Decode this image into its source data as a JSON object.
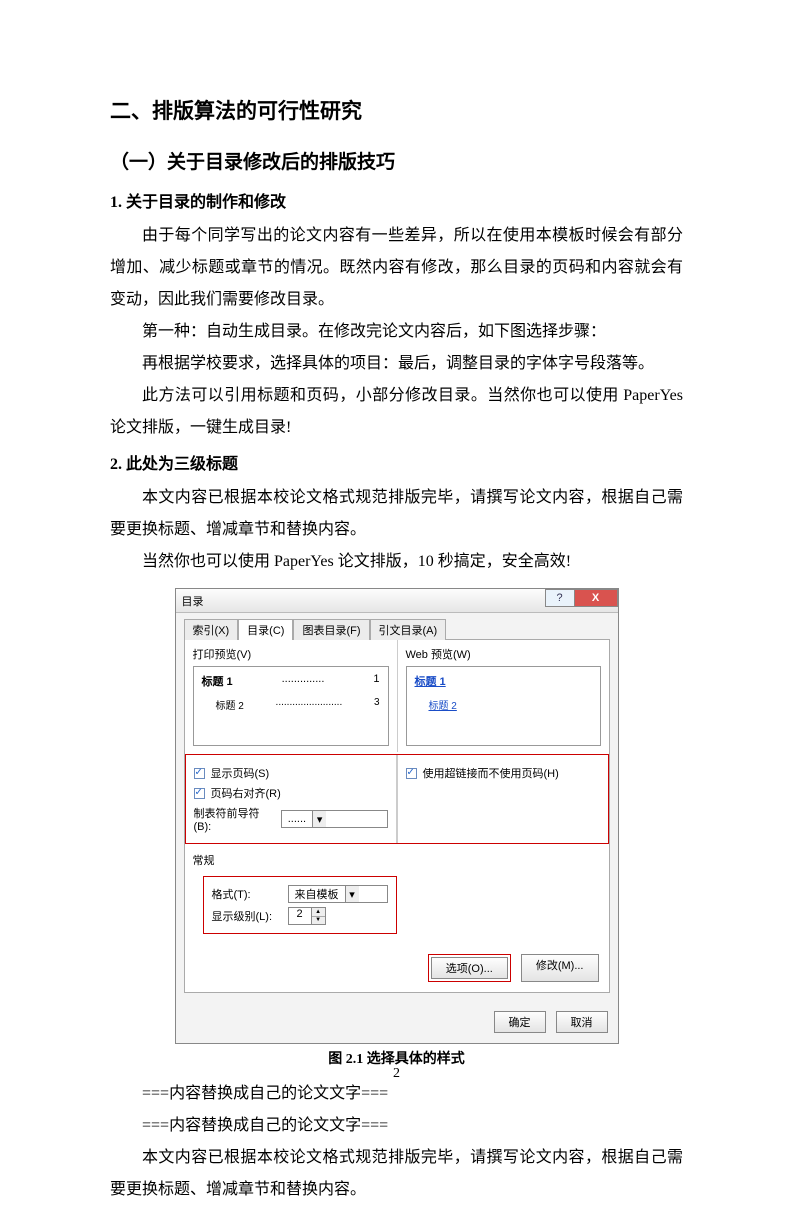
{
  "doc": {
    "h1": "二、排版算法的可行性研究",
    "h2": "（一）关于目录修改后的排版技巧",
    "h3_1": "1. 关于目录的制作和修改",
    "p1": "由于每个同学写出的论文内容有一些差异，所以在使用本模板时候会有部分增加、减少标题或章节的情况。既然内容有修改，那么目录的页码和内容就会有变动，因此我们需要修改目录。",
    "p2": "第一种：自动生成目录。在修改完论文内容后，如下图选择步骤：",
    "p3": "再根据学校要求，选择具体的项目：最后，调整目录的字体字号段落等。",
    "p4": "此方法可以引用标题和页码，小部分修改目录。当然你也可以使用 PaperYes 论文排版，一键生成目录!",
    "h3_2": "2. 此处为三级标题",
    "p5": "本文内容已根据本校论文格式规范排版完毕，请撰写论文内容，根据自己需要更换标题、增减章节和替换内容。",
    "p6": "当然你也可以使用 PaperYes 论文排版，10 秒搞定，安全高效!",
    "caption": "图 2.1  选择具体的样式",
    "p7": "===内容替换成自己的论文文字===",
    "p8": "===内容替换成自己的论文文字===",
    "p9": "本文内容已根据本校论文格式规范排版完毕，请撰写论文内容，根据自己需要更换标题、增减章节和替换内容。",
    "pagenum": "2"
  },
  "dialog": {
    "title": "目录",
    "help": "?",
    "close": "X",
    "tabs": [
      "索引(X)",
      "目录(C)",
      "图表目录(F)",
      "引文目录(A)"
    ],
    "active_tab": 1,
    "left_label": "打印预览(V)",
    "right_label": "Web 预览(W)",
    "preview_left_1": "标题 1",
    "preview_left_1_pg": "1",
    "preview_left_2": "标题 2",
    "preview_left_2_pg": "3",
    "preview_right_1": "标题 1",
    "preview_right_2": "标题 2",
    "chk_showpage": "显示页码(S)",
    "chk_rightalign": "页码右对齐(R)",
    "chk_hyperlink": "使用超链接而不使用页码(H)",
    "tab_leader_label": "制表符前导符(B):",
    "tab_leader_value": "......",
    "general_label": "常规",
    "format_label": "格式(T):",
    "format_value": "来自模板",
    "level_label": "显示级别(L):",
    "level_value": "2",
    "btn_options": "选项(O)...",
    "btn_modify": "修改(M)...",
    "btn_ok": "确定",
    "btn_cancel": "取消"
  }
}
